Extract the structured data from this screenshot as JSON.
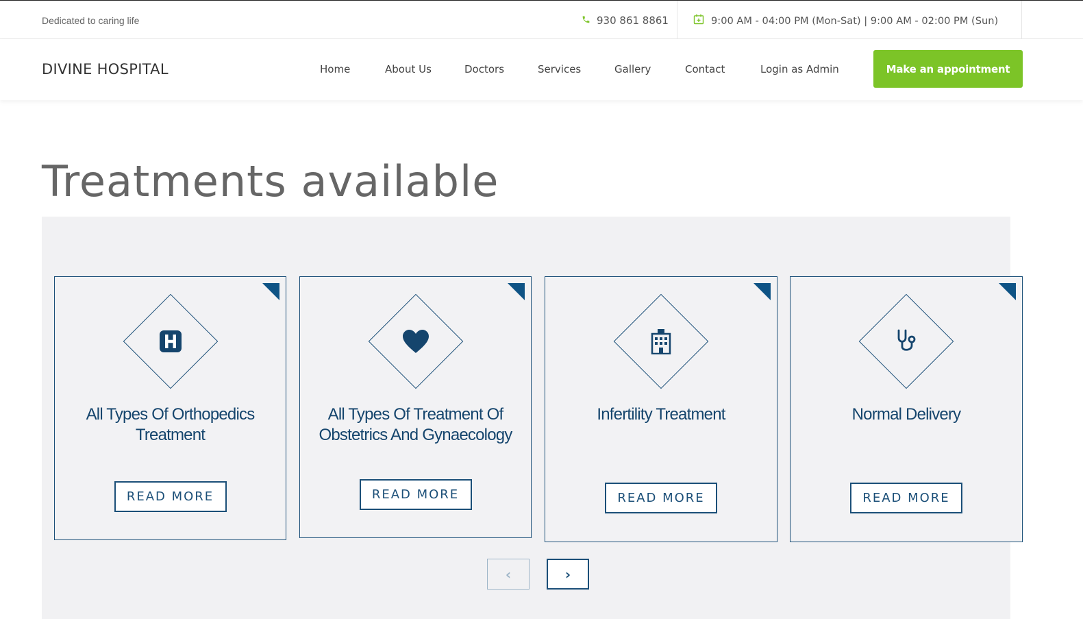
{
  "topbar": {
    "tagline": "Dedicated to caring life",
    "phone": "930 861 8861",
    "hours": "9:00 AM - 04:00 PM (Mon-Sat) | 9:00 AM - 02:00 PM (Sun)"
  },
  "header": {
    "brand": "DIVINE HOSPITAL",
    "nav": [
      "Home",
      "About Us",
      "Doctors",
      "Services",
      "Gallery",
      "Contact",
      "Login as Admin"
    ],
    "cta": "Make an appointment"
  },
  "section": {
    "title": "Treatments available",
    "cards": [
      {
        "title": "All Types Of Orthopedics Treatment",
        "button": "READ MORE",
        "icon": "hospital-icon"
      },
      {
        "title": "All Types Of Treatment Of Obstetrics And Gynaecology",
        "button": "READ MORE",
        "icon": "heart-icon"
      },
      {
        "title": "Infertility Treatment",
        "button": "READ MORE",
        "icon": "building-icon"
      },
      {
        "title": "Normal Delivery",
        "button": "READ MORE",
        "icon": "stethoscope-icon"
      }
    ],
    "prev": "‹",
    "next": "›"
  },
  "colors": {
    "accent_green": "#7cc427",
    "navy": "#1b4f78",
    "panel_bg": "#f1f1f3"
  }
}
